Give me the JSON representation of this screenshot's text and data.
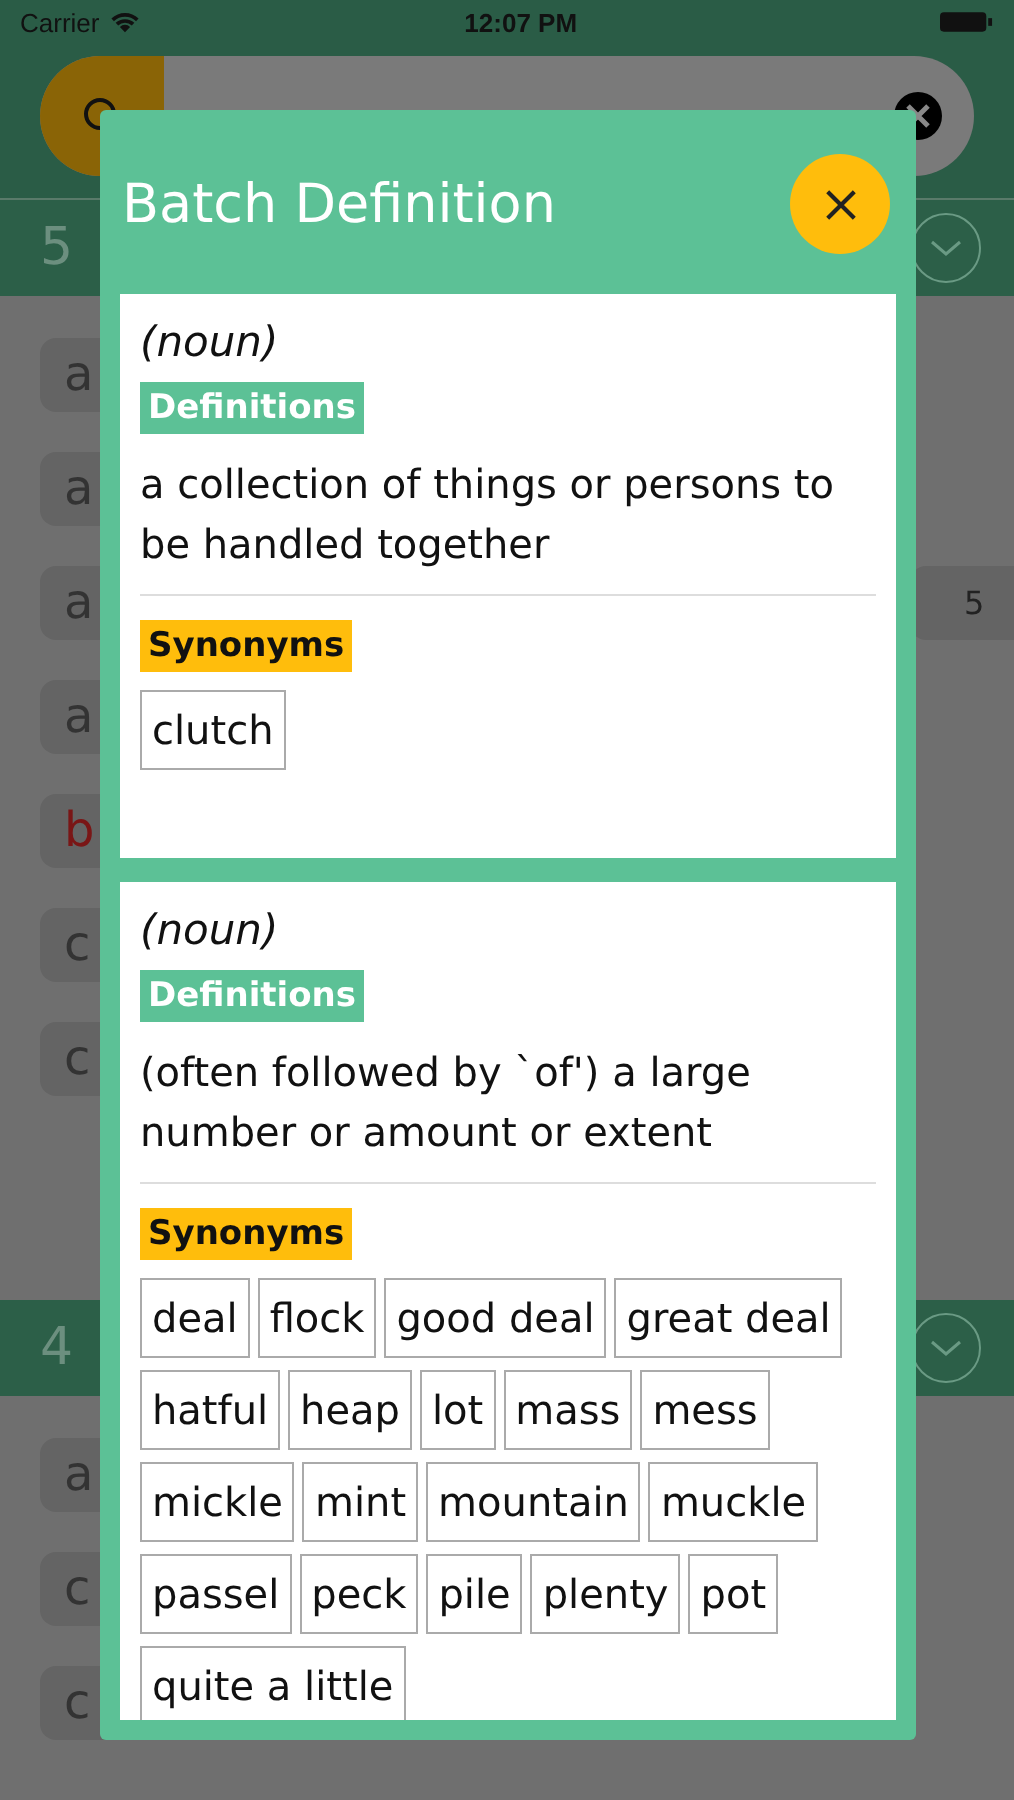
{
  "status_bar": {
    "carrier": "Carrier",
    "time": "12:07 PM"
  },
  "background": {
    "sections": [
      {
        "heading": "5",
        "items": [
          {
            "text": "a",
            "highlighted": false
          },
          {
            "text": "a",
            "highlighted": false
          },
          {
            "text": "a",
            "highlighted": false,
            "side": "5"
          },
          {
            "text": "a",
            "highlighted": false
          },
          {
            "text": "b",
            "highlighted": true
          },
          {
            "text": "c",
            "highlighted": false
          },
          {
            "text": "c",
            "highlighted": false
          }
        ]
      },
      {
        "heading": "4",
        "items": [
          {
            "text": "a",
            "highlighted": false
          },
          {
            "text": "c",
            "highlighted": false
          },
          {
            "text": "c",
            "highlighted": false
          }
        ]
      }
    ]
  },
  "dialog": {
    "title": "Batch Definition",
    "senses": [
      {
        "part_of_speech": "(noun)",
        "definitions_label": "Definitions",
        "definition": "a collection of things or persons to be handled together",
        "synonyms_label": "Synonyms",
        "synonyms": [
          "clutch"
        ]
      },
      {
        "part_of_speech": "(noun)",
        "definitions_label": "Definitions",
        "definition": "(often followed by `of') a large number or amount or extent",
        "synonyms_label": "Synonyms",
        "synonyms": [
          "deal",
          "flock",
          "good deal",
          "great deal",
          "hatful",
          "heap",
          "lot",
          "mass",
          "mess",
          "mickle",
          "mint",
          "mountain",
          "muckle",
          "passel",
          "peck",
          "pile",
          "plenty",
          "pot",
          "quite a little"
        ]
      }
    ]
  }
}
